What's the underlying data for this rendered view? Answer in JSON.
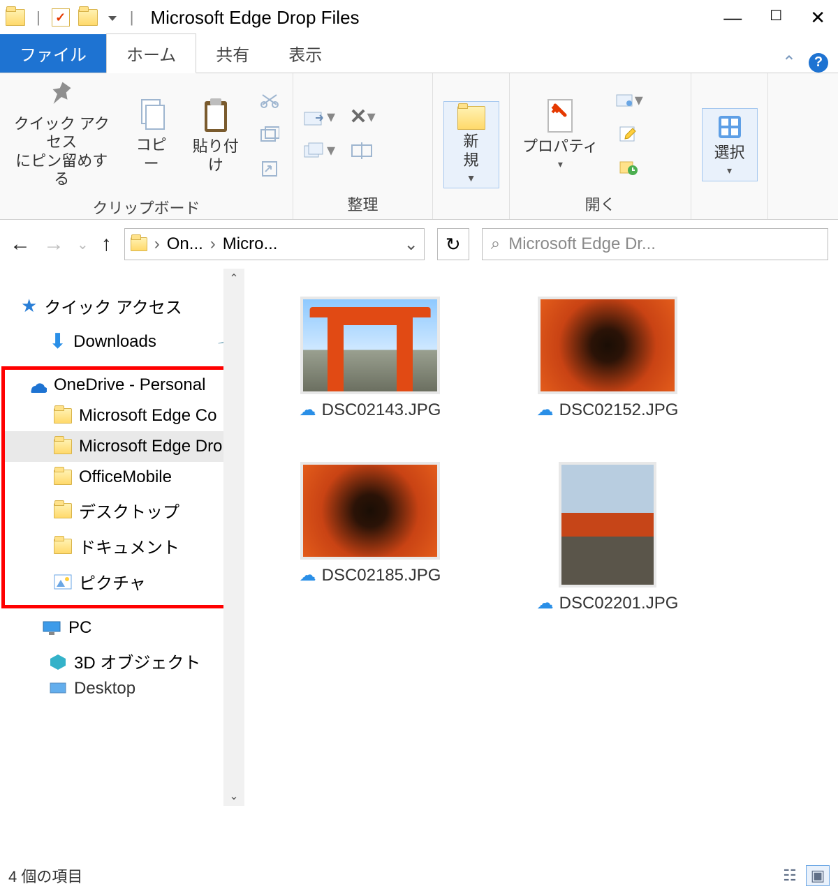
{
  "titlebar": {
    "title": "Microsoft Edge Drop Files"
  },
  "tabs": {
    "file": "ファイル",
    "home": "ホーム",
    "share": "共有",
    "view": "表示"
  },
  "ribbon": {
    "clipboard": {
      "pin": "クイック アクセス\nにピン留めする",
      "copy": "コピー",
      "paste": "貼り付け",
      "label": "クリップボード"
    },
    "organize": {
      "label": "整理"
    },
    "new": {
      "new": "新\n規",
      "label": ""
    },
    "open": {
      "properties": "プロパティ",
      "label": "開く"
    },
    "select": {
      "select": "選択",
      "label": ""
    }
  },
  "address": {
    "seg1": "On...",
    "seg2": "Micro..."
  },
  "search": {
    "placeholder": "Microsoft Edge Dr..."
  },
  "sidebar": {
    "quick": "クイック アクセス",
    "downloads": "Downloads",
    "onedrive": "OneDrive - Personal",
    "od_items": [
      "Microsoft Edge Co",
      "Microsoft Edge Dro",
      "OfficeMobile",
      "デスクトップ",
      "ドキュメント",
      "ピクチャ"
    ],
    "pc": "PC",
    "pc_items": [
      "3D オブジェクト",
      "Desktop"
    ]
  },
  "files": [
    {
      "name": "DSC02143.JPG",
      "kind": "torii",
      "orient": "land"
    },
    {
      "name": "DSC02152.JPG",
      "kind": "tunnel",
      "orient": "land"
    },
    {
      "name": "DSC02185.JPG",
      "kind": "tunnel",
      "orient": "land"
    },
    {
      "name": "DSC02201.JPG",
      "kind": "statue",
      "orient": "port"
    }
  ],
  "status": {
    "text": "4 個の項目"
  }
}
